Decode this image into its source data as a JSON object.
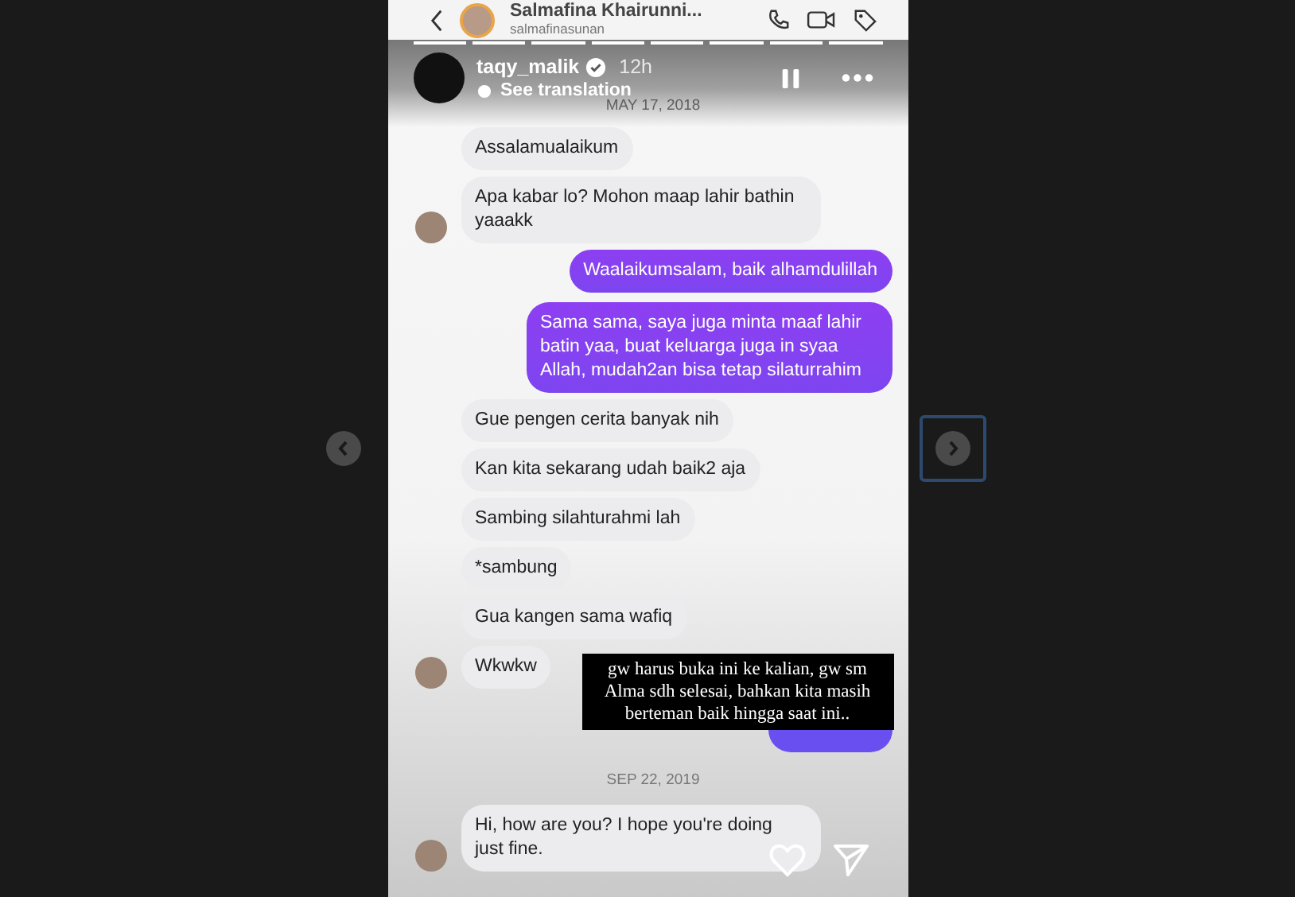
{
  "viewer": {
    "prev_button": {
      "focused": false
    },
    "next_button": {
      "focused": true
    }
  },
  "story": {
    "progress": [
      {
        "level": 1
      },
      {
        "level": 1
      },
      {
        "level": 1
      },
      {
        "level": 1
      },
      {
        "level": 1
      },
      {
        "level": 1
      },
      {
        "level": 1
      },
      {
        "level": 1
      }
    ],
    "user": {
      "name": "taqy_malik",
      "verified": true,
      "time": "12h",
      "translate": "See translation"
    },
    "caption": "gw harus buka ini ke kalian, gw sm Alma sdh selesai, bahkan kita masih berteman baik hingga saat ini.."
  },
  "chat": {
    "contact_name": "Salmafina Khairunni...",
    "contact_username": "salmafinasunan",
    "messages": [
      {
        "kind": "date",
        "text": "MAY 17, 2018"
      },
      {
        "kind": "received",
        "text": "Assalamualaikum",
        "avatar": false
      },
      {
        "kind": "received",
        "text": "Apa kabar lo? Mohon maap lahir bathin yaaakk",
        "avatar": true
      },
      {
        "kind": "sent",
        "text": "Waalaikumsalam, baik alhamdulillah"
      },
      {
        "kind": "sent",
        "text": "Sama sama, saya juga minta maaf lahir batin yaa, buat keluarga juga in syaa Allah, mudah2an bisa tetap silaturrahim"
      },
      {
        "kind": "received",
        "text": "Gue pengen cerita banyak nih",
        "avatar": false
      },
      {
        "kind": "received",
        "text": "Kan kita sekarang udah baik2 aja",
        "avatar": false
      },
      {
        "kind": "received",
        "text": "Sambing silahturahmi lah",
        "avatar": false
      },
      {
        "kind": "received",
        "text": "*sambung",
        "avatar": false
      },
      {
        "kind": "received",
        "text": "Gua kangen sama wafiq",
        "avatar": false
      },
      {
        "kind": "received",
        "text": "Wkwkw",
        "avatar": true
      },
      {
        "kind": "covered"
      },
      {
        "kind": "date",
        "text": "SEP 22, 2019"
      },
      {
        "kind": "received",
        "text": "Hi, how are you? I hope you're doing just fine.",
        "avatar": true
      }
    ]
  }
}
